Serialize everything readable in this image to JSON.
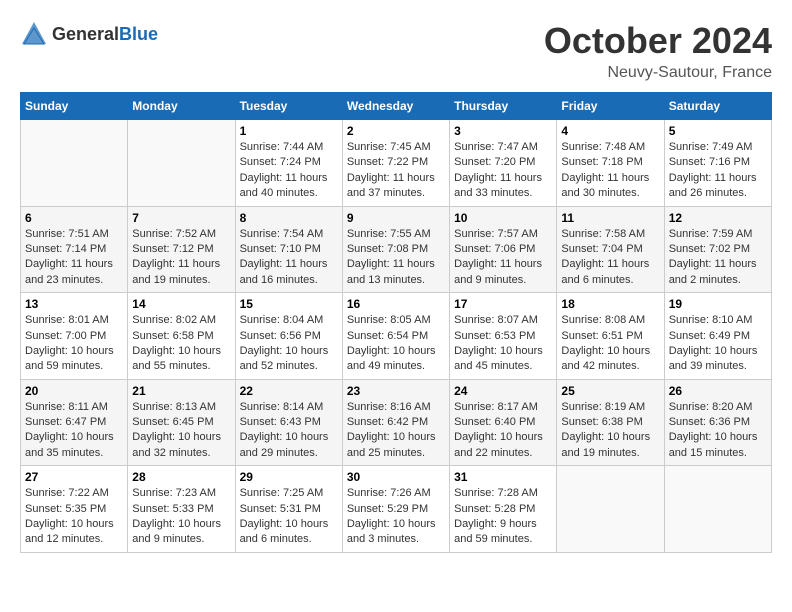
{
  "header": {
    "logo_general": "General",
    "logo_blue": "Blue",
    "month": "October 2024",
    "location": "Neuvy-Sautour, France"
  },
  "days_of_week": [
    "Sunday",
    "Monday",
    "Tuesday",
    "Wednesday",
    "Thursday",
    "Friday",
    "Saturday"
  ],
  "weeks": [
    [
      {
        "day": "",
        "info": ""
      },
      {
        "day": "",
        "info": ""
      },
      {
        "day": "1",
        "info": "Sunrise: 7:44 AM\nSunset: 7:24 PM\nDaylight: 11 hours and 40 minutes."
      },
      {
        "day": "2",
        "info": "Sunrise: 7:45 AM\nSunset: 7:22 PM\nDaylight: 11 hours and 37 minutes."
      },
      {
        "day": "3",
        "info": "Sunrise: 7:47 AM\nSunset: 7:20 PM\nDaylight: 11 hours and 33 minutes."
      },
      {
        "day": "4",
        "info": "Sunrise: 7:48 AM\nSunset: 7:18 PM\nDaylight: 11 hours and 30 minutes."
      },
      {
        "day": "5",
        "info": "Sunrise: 7:49 AM\nSunset: 7:16 PM\nDaylight: 11 hours and 26 minutes."
      }
    ],
    [
      {
        "day": "6",
        "info": "Sunrise: 7:51 AM\nSunset: 7:14 PM\nDaylight: 11 hours and 23 minutes."
      },
      {
        "day": "7",
        "info": "Sunrise: 7:52 AM\nSunset: 7:12 PM\nDaylight: 11 hours and 19 minutes."
      },
      {
        "day": "8",
        "info": "Sunrise: 7:54 AM\nSunset: 7:10 PM\nDaylight: 11 hours and 16 minutes."
      },
      {
        "day": "9",
        "info": "Sunrise: 7:55 AM\nSunset: 7:08 PM\nDaylight: 11 hours and 13 minutes."
      },
      {
        "day": "10",
        "info": "Sunrise: 7:57 AM\nSunset: 7:06 PM\nDaylight: 11 hours and 9 minutes."
      },
      {
        "day": "11",
        "info": "Sunrise: 7:58 AM\nSunset: 7:04 PM\nDaylight: 11 hours and 6 minutes."
      },
      {
        "day": "12",
        "info": "Sunrise: 7:59 AM\nSunset: 7:02 PM\nDaylight: 11 hours and 2 minutes."
      }
    ],
    [
      {
        "day": "13",
        "info": "Sunrise: 8:01 AM\nSunset: 7:00 PM\nDaylight: 10 hours and 59 minutes."
      },
      {
        "day": "14",
        "info": "Sunrise: 8:02 AM\nSunset: 6:58 PM\nDaylight: 10 hours and 55 minutes."
      },
      {
        "day": "15",
        "info": "Sunrise: 8:04 AM\nSunset: 6:56 PM\nDaylight: 10 hours and 52 minutes."
      },
      {
        "day": "16",
        "info": "Sunrise: 8:05 AM\nSunset: 6:54 PM\nDaylight: 10 hours and 49 minutes."
      },
      {
        "day": "17",
        "info": "Sunrise: 8:07 AM\nSunset: 6:53 PM\nDaylight: 10 hours and 45 minutes."
      },
      {
        "day": "18",
        "info": "Sunrise: 8:08 AM\nSunset: 6:51 PM\nDaylight: 10 hours and 42 minutes."
      },
      {
        "day": "19",
        "info": "Sunrise: 8:10 AM\nSunset: 6:49 PM\nDaylight: 10 hours and 39 minutes."
      }
    ],
    [
      {
        "day": "20",
        "info": "Sunrise: 8:11 AM\nSunset: 6:47 PM\nDaylight: 10 hours and 35 minutes."
      },
      {
        "day": "21",
        "info": "Sunrise: 8:13 AM\nSunset: 6:45 PM\nDaylight: 10 hours and 32 minutes."
      },
      {
        "day": "22",
        "info": "Sunrise: 8:14 AM\nSunset: 6:43 PM\nDaylight: 10 hours and 29 minutes."
      },
      {
        "day": "23",
        "info": "Sunrise: 8:16 AM\nSunset: 6:42 PM\nDaylight: 10 hours and 25 minutes."
      },
      {
        "day": "24",
        "info": "Sunrise: 8:17 AM\nSunset: 6:40 PM\nDaylight: 10 hours and 22 minutes."
      },
      {
        "day": "25",
        "info": "Sunrise: 8:19 AM\nSunset: 6:38 PM\nDaylight: 10 hours and 19 minutes."
      },
      {
        "day": "26",
        "info": "Sunrise: 8:20 AM\nSunset: 6:36 PM\nDaylight: 10 hours and 15 minutes."
      }
    ],
    [
      {
        "day": "27",
        "info": "Sunrise: 7:22 AM\nSunset: 5:35 PM\nDaylight: 10 hours and 12 minutes."
      },
      {
        "day": "28",
        "info": "Sunrise: 7:23 AM\nSunset: 5:33 PM\nDaylight: 10 hours and 9 minutes."
      },
      {
        "day": "29",
        "info": "Sunrise: 7:25 AM\nSunset: 5:31 PM\nDaylight: 10 hours and 6 minutes."
      },
      {
        "day": "30",
        "info": "Sunrise: 7:26 AM\nSunset: 5:29 PM\nDaylight: 10 hours and 3 minutes."
      },
      {
        "day": "31",
        "info": "Sunrise: 7:28 AM\nSunset: 5:28 PM\nDaylight: 9 hours and 59 minutes."
      },
      {
        "day": "",
        "info": ""
      },
      {
        "day": "",
        "info": ""
      }
    ]
  ]
}
